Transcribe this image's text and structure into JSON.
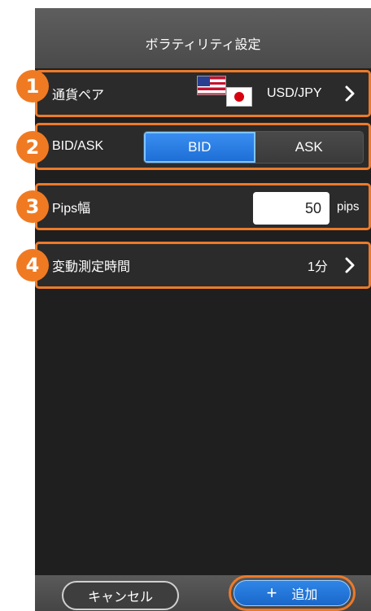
{
  "header": {
    "title": "ボラティリティ設定"
  },
  "rows": {
    "pair": {
      "badge": "1",
      "label": "通貨ペア",
      "value": "USD/JPY",
      "flags": [
        "us-flag-icon",
        "jp-flag-icon"
      ]
    },
    "bidask": {
      "badge": "2",
      "label": "BID/ASK",
      "options": [
        "BID",
        "ASK"
      ],
      "selected": "BID"
    },
    "pips": {
      "badge": "3",
      "label": "Pips幅",
      "value": "50",
      "unit": "pips"
    },
    "duration": {
      "badge": "4",
      "label": "変動測定時間",
      "value": "1分"
    }
  },
  "footer": {
    "cancel_label": "キャンセル",
    "add_label": "追加",
    "add_icon": "plus-icon"
  },
  "colors": {
    "accent": "#ec7a2a",
    "active": "#1d6fd6",
    "background": "#1f1f1f"
  }
}
